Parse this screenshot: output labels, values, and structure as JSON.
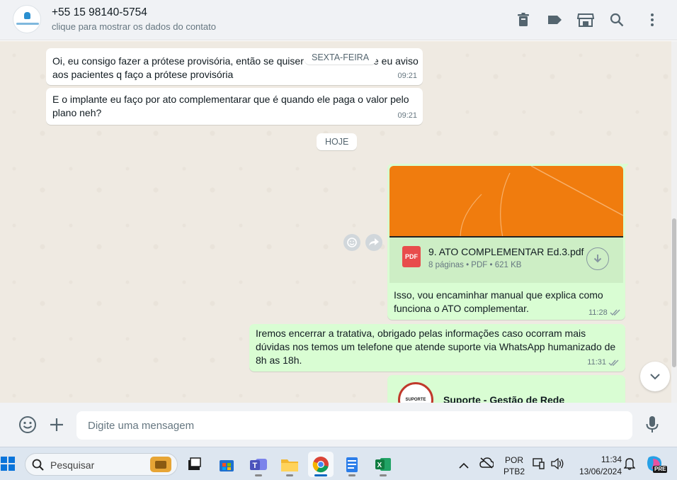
{
  "header": {
    "contact_name": "+55 15 98140-5754",
    "contact_subtitle": "clique para mostrar os dados do contato"
  },
  "chat": {
    "day_labels": {
      "friday": "SEXTA-FEIRA",
      "today": "HOJE"
    },
    "messages": [
      {
        "line1": "Oi, eu consigo fazer a prótese provisória,  então se quiser",
        "line1b": "e eu aviso",
        "line2": "aos pacientes q faço a prótese provisória",
        "time": "09:21"
      },
      {
        "line1": "E o implante eu faço por ato complementarar que é quando ele paga o valor pelo",
        "line2": "plano neh?",
        "time": "09:21"
      },
      {
        "line1": "Isso, vou encaminhar manual que explica como",
        "line2": "funciona o ATO complementar.",
        "time": "11:28"
      },
      {
        "line1": "Iremos encerrar a tratativa, obrigado pelas informações caso ocorram mais",
        "line2": "dúvidas nos temos um telefone que atende suporte via WhatsApp humanizado de",
        "line3": "8h as 18h.",
        "time": "11:31"
      }
    ],
    "document": {
      "icon_label": "PDF",
      "name": "9. ATO COMPLEMENTAR Ed.3.pdf",
      "meta": "8 páginas • PDF • 621 KB"
    },
    "contact_card": {
      "name": "Suporte - Gestão de Rede",
      "badge_text": "SUPORTE"
    }
  },
  "composer": {
    "placeholder": "Digite uma mensagem"
  },
  "taskbar": {
    "search_label": "Pesquisar",
    "lang_line1": "POR",
    "lang_line2": "PTB2",
    "time": "11:34",
    "date": "13/06/2024",
    "copilot_badge": "PRE"
  },
  "colors": {
    "outgoing_bubble": "#d9fdd3",
    "incoming_bubble": "#ffffff",
    "chat_bg": "#efeae2",
    "accent": "#00a884"
  }
}
